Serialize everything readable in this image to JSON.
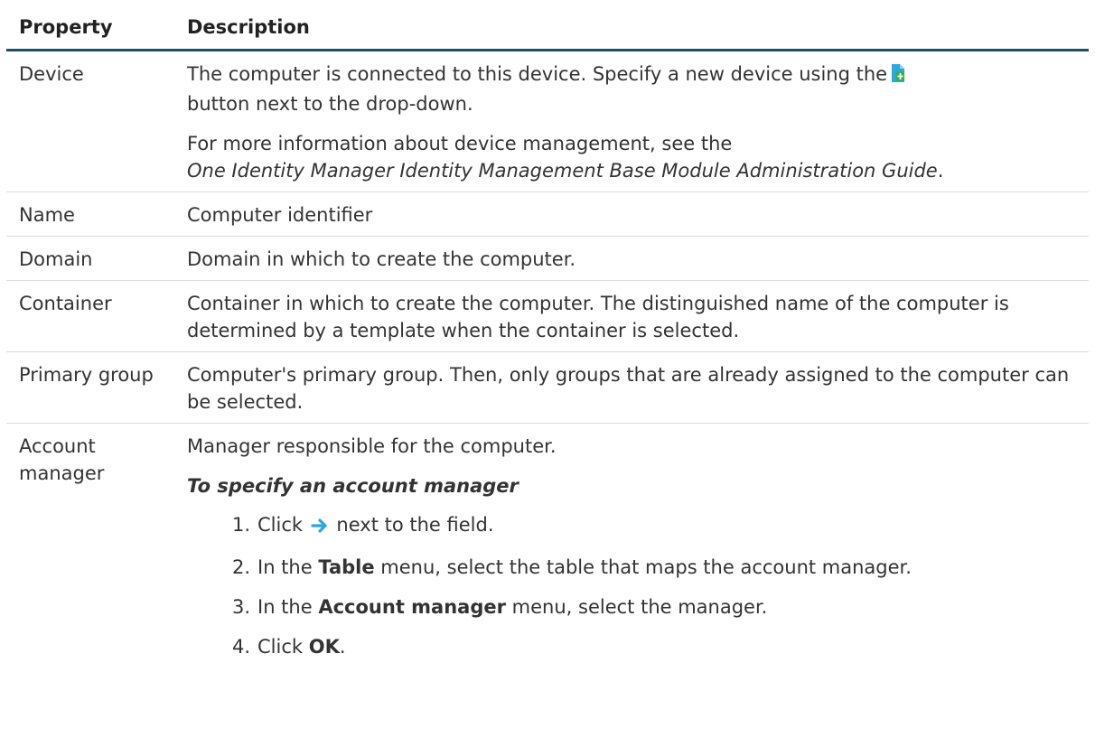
{
  "header": {
    "property": "Property",
    "description": "Description"
  },
  "rows": {
    "device": {
      "property": "Device",
      "desc_1_before_icon": "The computer is connected to this device. Specify a new device using the",
      "desc_1_after_icon": "button next to the drop-down.",
      "desc_2_plain": "For more information about device management, see the",
      "desc_2_italic": "One Identity Manager Identity Management Base Module Administration Guide",
      "desc_2_end": "."
    },
    "name": {
      "property": "Name",
      "description": "Computer identifier"
    },
    "domain": {
      "property": "Domain",
      "description": "Domain in which to create the computer."
    },
    "container": {
      "property": "Container",
      "description": "Container in which to create the computer. The distinguished name of the computer is determined by a template when the container is selected."
    },
    "primary_group": {
      "property": "Primary group",
      "description": "Computer's primary group. Then, only groups that are already assigned to the computer can be selected."
    },
    "account_manager": {
      "property": "Account manager",
      "description": "Manager responsible for the computer.",
      "procedure_title": "To specify an account manager",
      "steps": {
        "s1": {
          "num": "1.",
          "before": "Click",
          "after": "next to the field."
        },
        "s2": {
          "num": "2.",
          "before": "In the",
          "bold": "Table",
          "after": "menu, select the table that maps the account manager."
        },
        "s3": {
          "num": "3.",
          "before": "In the",
          "bold": "Account manager",
          "after": "menu, select the manager."
        },
        "s4": {
          "num": "4.",
          "before": "Click",
          "bold": "OK",
          "after": "."
        }
      }
    }
  },
  "icons": {
    "new_device": "new-document-icon",
    "arrow": "arrow-right-icon"
  },
  "colors": {
    "header_rule": "#1d4f5e",
    "icon_blue": "#2aa7df",
    "icon_green": "#3fae49"
  }
}
